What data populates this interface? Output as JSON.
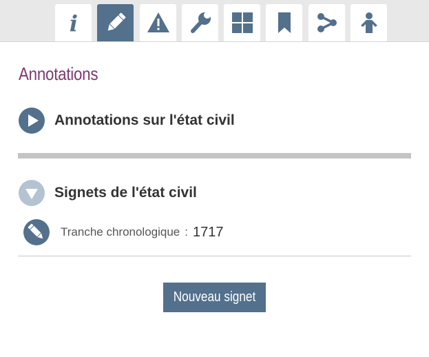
{
  "tabs": [
    {
      "icon": "info-icon",
      "active": false
    },
    {
      "icon": "pencil-icon",
      "active": true
    },
    {
      "icon": "warning-icon",
      "active": false
    },
    {
      "icon": "wrench-icon",
      "active": false
    },
    {
      "icon": "grid-icon",
      "active": false
    },
    {
      "icon": "bookmark-icon",
      "active": false
    },
    {
      "icon": "share-icon",
      "active": false
    },
    {
      "icon": "person-icon",
      "active": false
    }
  ],
  "page": {
    "heading": "Annotations"
  },
  "sections": [
    {
      "title": "Annotations sur l'état civil",
      "state": "collapsed",
      "icon": "play-icon"
    },
    {
      "title": "Signets de l'état civil",
      "state": "expanded",
      "icon": "chevron-down-icon"
    }
  ],
  "bookmark": {
    "label": "Tranche chronologique",
    "separator": ":",
    "value": "1717",
    "icon": "pencil-icon"
  },
  "actions": {
    "new_bookmark": "Nouveau signet"
  },
  "colors": {
    "accent": "#53708d",
    "accent_light": "#b3c3d2",
    "heading": "#7d3a72",
    "tabbar_bg": "#e8e8e8"
  }
}
